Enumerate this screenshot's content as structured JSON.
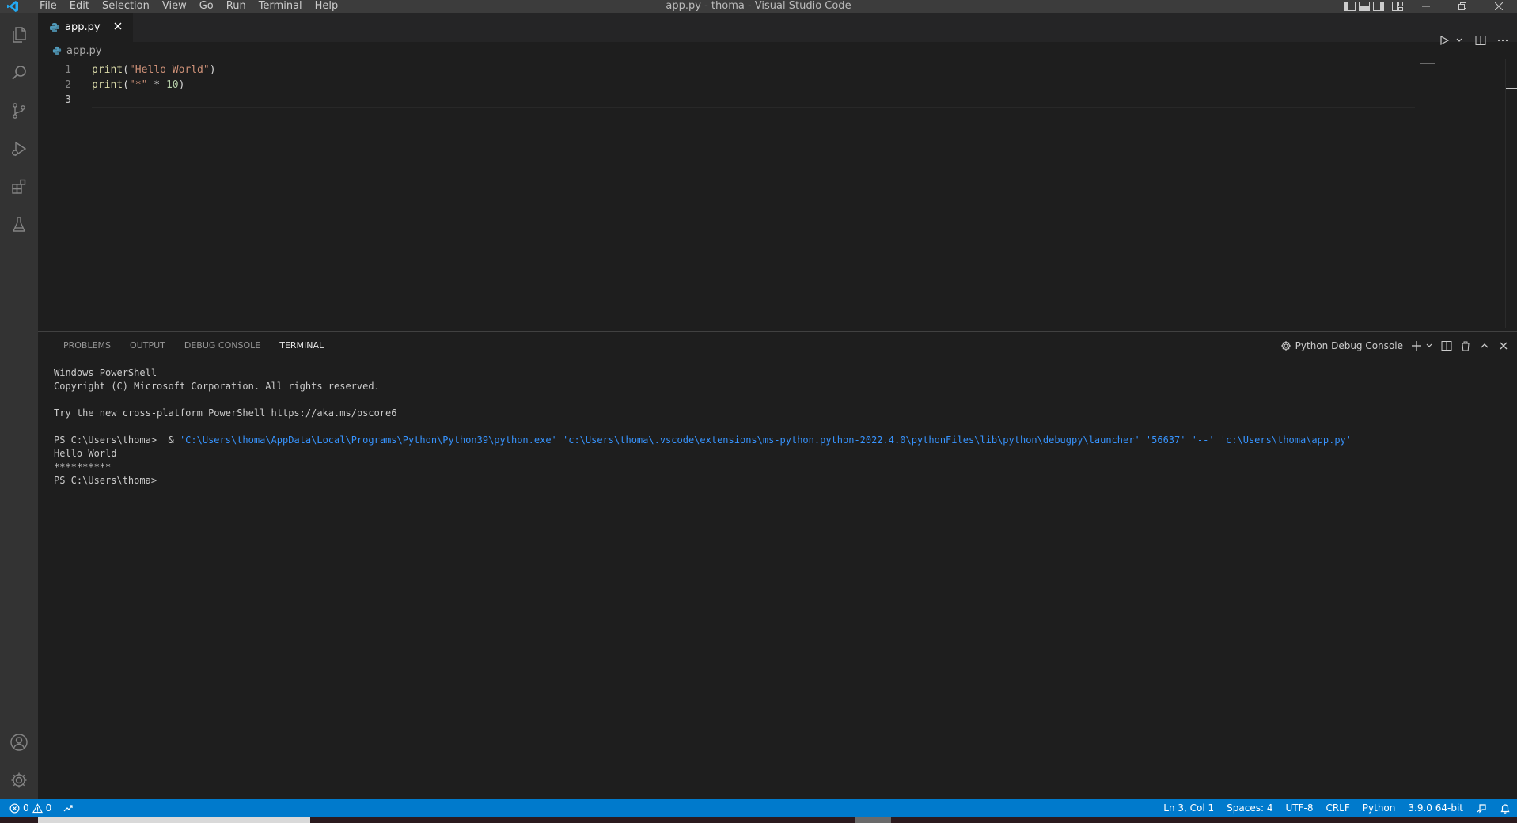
{
  "window": {
    "title": "app.py - thoma - Visual Studio Code",
    "menu": [
      "File",
      "Edit",
      "Selection",
      "View",
      "Go",
      "Run",
      "Terminal",
      "Help"
    ]
  },
  "activity_bar": {
    "items": [
      "explorer-icon",
      "search-icon",
      "source-control-icon",
      "run-debug-icon",
      "extensions-icon",
      "testing-icon"
    ],
    "bottom": [
      "accounts-icon",
      "manage-gear-icon"
    ]
  },
  "editor": {
    "tab": {
      "label": "app.py"
    },
    "breadcrumb": "app.py",
    "lines": [
      {
        "number": "1",
        "tokens": [
          {
            "t": "print",
            "c": "fn"
          },
          {
            "t": "(",
            "c": "punc"
          },
          {
            "t": "\"Hello World\"",
            "c": "str"
          },
          {
            "t": ")",
            "c": "punc"
          }
        ]
      },
      {
        "number": "2",
        "tokens": [
          {
            "t": "print",
            "c": "fn"
          },
          {
            "t": "(",
            "c": "punc"
          },
          {
            "t": "\"*\"",
            "c": "str"
          },
          {
            "t": " * ",
            "c": "punc"
          },
          {
            "t": "10",
            "c": "num"
          },
          {
            "t": ")",
            "c": "punc"
          }
        ]
      },
      {
        "number": "3",
        "tokens": []
      }
    ]
  },
  "panel": {
    "tabs": [
      "PROBLEMS",
      "OUTPUT",
      "DEBUG CONSOLE",
      "TERMINAL"
    ],
    "active_tab": "TERMINAL",
    "terminal_name": "Python Debug Console",
    "terminal_lines": {
      "l1": "Windows PowerShell",
      "l2": "Copyright (C) Microsoft Corporation. All rights reserved.",
      "l3": "",
      "l4": "Try the new cross-platform PowerShell https://aka.ms/pscore6",
      "l5": "",
      "l6_prompt": "PS C:\\Users\\thoma>  & ",
      "l6_cmd": "'C:\\Users\\thoma\\AppData\\Local\\Programs\\Python\\Python39\\python.exe' 'c:\\Users\\thoma\\.vscode\\extensions\\ms-python.python-2022.4.0\\pythonFiles\\lib\\python\\debugpy\\launcher' '56637' '--' 'c:\\Users\\thoma\\app.py'",
      "l7": "Hello World",
      "l8": "**********",
      "l9": "PS C:\\Users\\thoma>"
    }
  },
  "statusbar": {
    "errors": "0",
    "warnings": "0",
    "position": "Ln 3, Col 1",
    "spaces": "Spaces: 4",
    "encoding": "UTF-8",
    "eol": "CRLF",
    "language": "Python",
    "interpreter": "3.9.0 64-bit"
  },
  "colors": {
    "accent": "#007acc",
    "background": "#1e1e1e",
    "activity_bar": "#333333"
  }
}
